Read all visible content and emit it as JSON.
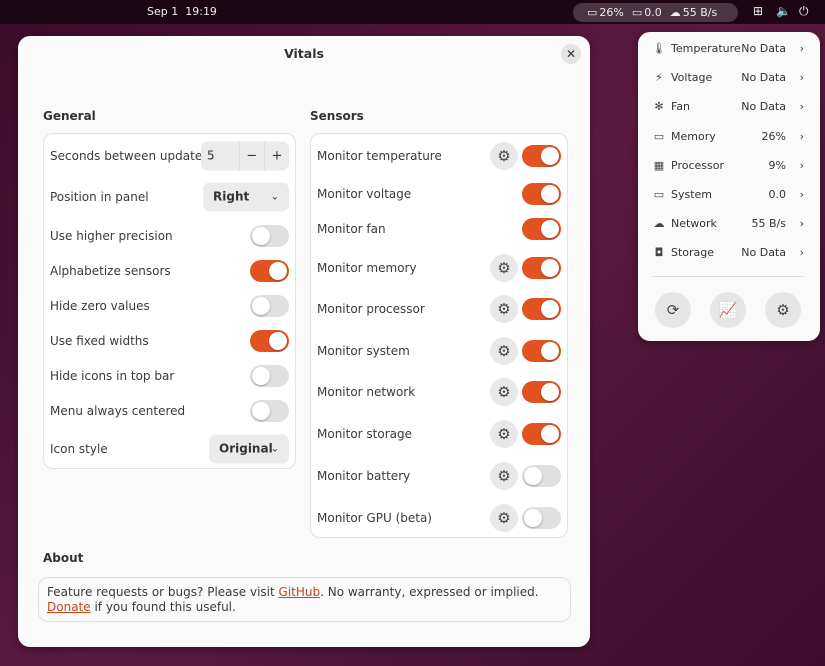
{
  "topbar": {
    "date": "Sep 1",
    "time": "19:19",
    "memory": "26%",
    "system": "0.0",
    "network": "55 B/s"
  },
  "dialog": {
    "title": "Vitals",
    "close": "✕"
  },
  "general": {
    "heading": "General",
    "rows": [
      {
        "label": "Seconds between updates",
        "type": "spin",
        "value": "5",
        "minus": "−",
        "plus": "+"
      },
      {
        "label": "Position in panel",
        "type": "drop",
        "value": "Right"
      },
      {
        "label": "Use higher precision",
        "type": "toggle",
        "on": false
      },
      {
        "label": "Alphabetize sensors",
        "type": "toggle",
        "on": true
      },
      {
        "label": "Hide zero values",
        "type": "toggle",
        "on": false
      },
      {
        "label": "Use fixed widths",
        "type": "toggle",
        "on": true
      },
      {
        "label": "Hide icons in top bar",
        "type": "toggle",
        "on": false
      },
      {
        "label": "Menu always centered",
        "type": "toggle",
        "on": false
      },
      {
        "label": "Icon style",
        "type": "drop",
        "value": "Original"
      }
    ]
  },
  "sensors": {
    "heading": "Sensors",
    "rows": [
      {
        "label": "Monitor temperature",
        "gear": true,
        "on": true
      },
      {
        "label": "Monitor voltage",
        "gear": false,
        "on": true
      },
      {
        "label": "Monitor fan",
        "gear": false,
        "on": true
      },
      {
        "label": "Monitor memory",
        "gear": true,
        "on": true
      },
      {
        "label": "Monitor processor",
        "gear": true,
        "on": true
      },
      {
        "label": "Monitor system",
        "gear": true,
        "on": true
      },
      {
        "label": "Monitor network",
        "gear": true,
        "on": true
      },
      {
        "label": "Monitor storage",
        "gear": true,
        "on": true
      },
      {
        "label": "Monitor battery",
        "gear": true,
        "on": false
      },
      {
        "label": "Monitor GPU (beta)",
        "gear": true,
        "on": false
      }
    ]
  },
  "about": {
    "heading": "About",
    "text1": "Feature requests or bugs? Please visit ",
    "link1": "GitHub",
    "text2": ". No warranty, expressed or implied. ",
    "link2": "Donate",
    "text3": " if you found this useful."
  },
  "menu": {
    "items": [
      {
        "icon": "thermometer-icon",
        "glyph": "🌡",
        "name": "Temperature",
        "value": "No Data"
      },
      {
        "icon": "voltage-icon",
        "glyph": "⚡",
        "name": "Voltage",
        "value": "No Data"
      },
      {
        "icon": "fan-icon",
        "glyph": "✻",
        "name": "Fan",
        "value": "No Data"
      },
      {
        "icon": "memory-icon",
        "glyph": "▭",
        "name": "Memory",
        "value": "26%"
      },
      {
        "icon": "processor-icon",
        "glyph": "▦",
        "name": "Processor",
        "value": "9%"
      },
      {
        "icon": "monitor-icon",
        "glyph": "▭",
        "name": "System",
        "value": "0.0"
      },
      {
        "icon": "cloud-icon",
        "glyph": "☁",
        "name": "Network",
        "value": "55 B/s"
      },
      {
        "icon": "storage-icon",
        "glyph": "◘",
        "name": "Storage",
        "value": "No Data"
      }
    ]
  },
  "colors": {
    "accent": "#e2531f"
  }
}
